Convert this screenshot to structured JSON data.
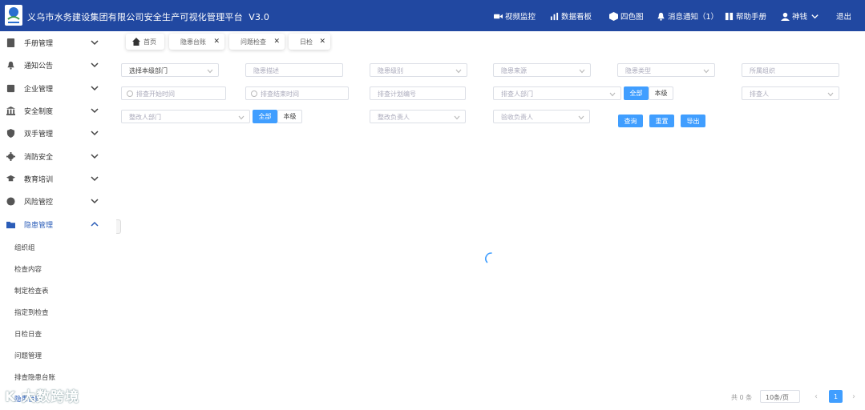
{
  "header": {
    "title": "义乌市水务建设集团有限公司安全生产可视化管理平台",
    "version": "V3.0",
    "nav": [
      {
        "label": "视频监控",
        "icon": "video-camera-icon"
      },
      {
        "label": "数据看板",
        "icon": "bar-chart-icon"
      },
      {
        "label": "四色图",
        "icon": "cube-icon"
      },
      {
        "label": "消息通知（1）",
        "icon": "bell-icon"
      },
      {
        "label": "帮助手册",
        "icon": "book-icon"
      },
      {
        "label": "神钱",
        "icon": "user-icon"
      },
      {
        "label": "退出",
        "icon": "logout-icon"
      }
    ]
  },
  "sidebar": {
    "items": [
      {
        "label": "手册管理",
        "icon": "manual-icon"
      },
      {
        "label": "通知公告",
        "icon": "bell-icon"
      },
      {
        "label": "企业管理",
        "icon": "company-icon"
      },
      {
        "label": "安全制度",
        "icon": "bank-icon"
      },
      {
        "label": "双手管理",
        "icon": "shield-icon"
      },
      {
        "label": "消防安全",
        "icon": "gear-icon"
      },
      {
        "label": "教育培训",
        "icon": "graduation-cap-icon"
      },
      {
        "label": "风险管控",
        "icon": "globe-icon"
      },
      {
        "label": "隐患管理",
        "icon": "folder-icon"
      }
    ],
    "sub_items": [
      "组织组",
      "检查内容",
      "制定检查表",
      "指定到检查",
      "日检日查",
      "问题管理",
      "排查隐患台账",
      "隐患台账"
    ]
  },
  "tabs": [
    {
      "label": "首页"
    },
    {
      "label": "隐患台账"
    },
    {
      "label": "问题检查"
    },
    {
      "label": "日检"
    }
  ],
  "filters": {
    "row1": [
      {
        "placeholder": "",
        "value": "选择本级部门"
      },
      {
        "placeholder": "隐患描述",
        "value": ""
      },
      {
        "placeholder": "隐患级别",
        "value": ""
      },
      {
        "placeholder": "隐患来源",
        "value": ""
      },
      {
        "placeholder": "隐患类型",
        "value": ""
      },
      {
        "placeholder": "所属组织",
        "value": ""
      }
    ],
    "row2": [
      {
        "placeholder": "排查开始时间"
      },
      {
        "placeholder": "排查结束时间"
      },
      {
        "placeholder": "排查计划编号"
      },
      {
        "placeholder": "排查人部门"
      },
      {
        "placeholder": "排查人"
      }
    ],
    "row3": [
      {
        "placeholder": "整改人部门"
      },
      {
        "placeholder": "整改负责人"
      },
      {
        "placeholder": "验收负责人"
      }
    ],
    "seg_all": "全部",
    "seg_level": "本级",
    "buttons": {
      "query": "查询",
      "reset": "重置",
      "export": "导出"
    }
  },
  "pagination": {
    "total": "共 0 条",
    "page_size": "10条/页",
    "current": "1"
  },
  "watermark": "K 大数跨境"
}
